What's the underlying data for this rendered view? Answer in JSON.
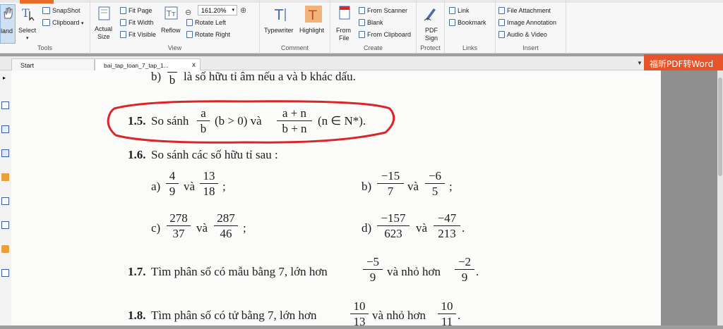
{
  "ribbon": {
    "hand_label": "land",
    "select_label": "Select",
    "snapshot_label": "SnapShot",
    "clipboard_label": "Clipboard",
    "tools_group": "Tools",
    "actual_size_label1": "Actual",
    "actual_size_label2": "Size",
    "fit_page": "Fit Page",
    "fit_width": "Fit Width",
    "fit_visible": "Fit Visible",
    "reflow": "Reflow",
    "zoom_value": "161.20%",
    "rotate_left": "Rotate Left",
    "rotate_right": "Rotate Right",
    "view_group": "View",
    "typewriter": "Typewriter",
    "highlight": "Highlight",
    "comment_group": "Comment",
    "from_file1": "From",
    "from_file2": "File",
    "from_scanner": "From Scanner",
    "blank": "Blank",
    "from_clipboard": "From Clipboard",
    "create_group": "Create",
    "pdf_sign1": "PDF",
    "pdf_sign2": "Sign",
    "protect_group": "Protect",
    "link": "Link",
    "bookmark": "Bookmark",
    "links_group": "Links",
    "file_attachment": "File Attachment",
    "image_annotation": "Image Annotation",
    "audio_video": "Audio & Video",
    "insert_group": "Insert"
  },
  "tabs": {
    "start": "Start",
    "doc": "bai_tap_toan_7_tap_1...",
    "close": "x",
    "banner": "福昕PDF转Word"
  },
  "doc": {
    "l0_prefix": "b)",
    "l0_frac_d": "b",
    "l0_text": "là số hữu tỉ âm nếu a và b khác dấu.",
    "p15_num": "1.5.",
    "p15_text1": "So sánh",
    "p15_f1n": "a",
    "p15_f1d": "b",
    "p15_text2": "(b > 0) và",
    "p15_f2n": "a + n",
    "p15_f2d": "b + n",
    "p15_text3": "(n ∈ N*).",
    "p16_num": "1.6.",
    "p16_text": "So sánh các số hữu tỉ sau :",
    "a_label": "a)",
    "a_f1n": "4",
    "a_f1d": "9",
    "a_va": "và",
    "a_f2n": "13",
    "a_f2d": "18",
    "a_end": ";",
    "b_label": "b)",
    "b_f1n": "−15",
    "b_f1d": "7",
    "b_va": "và",
    "b_f2n": "−6",
    "b_f2d": "5",
    "b_end": ";",
    "c_label": "c)",
    "c_f1n": "278",
    "c_f1d": "37",
    "c_va": "và",
    "c_f2n": "287",
    "c_f2d": "46",
    "c_end": ";",
    "d_label": "d)",
    "d_f1n": "−157",
    "d_f1d": "623",
    "d_va": "và",
    "d_f2n": "−47",
    "d_f2d": "213",
    "d_end": ".",
    "p17_num": "1.7.",
    "p17_text1": "Tìm phân số có mẫu bằng 7, lớn hơn",
    "p17_f1n": "−5",
    "p17_f1d": "9",
    "p17_text2": "và nhỏ hơn",
    "p17_f2n": "−2",
    "p17_f2d": "9",
    "p17_end": ".",
    "p18_num": "1.8.",
    "p18_text1": "Tìm phân số có tử bằng 7, lớn hơn",
    "p18_f1n": "10",
    "p18_f1d": "13",
    "p18_text2": "và nhỏ hơn",
    "p18_f2n": "10",
    "p18_f2d": "11",
    "p18_end": "."
  },
  "colors": {
    "accent": "#e8542a",
    "annotation": "#d8262b"
  }
}
